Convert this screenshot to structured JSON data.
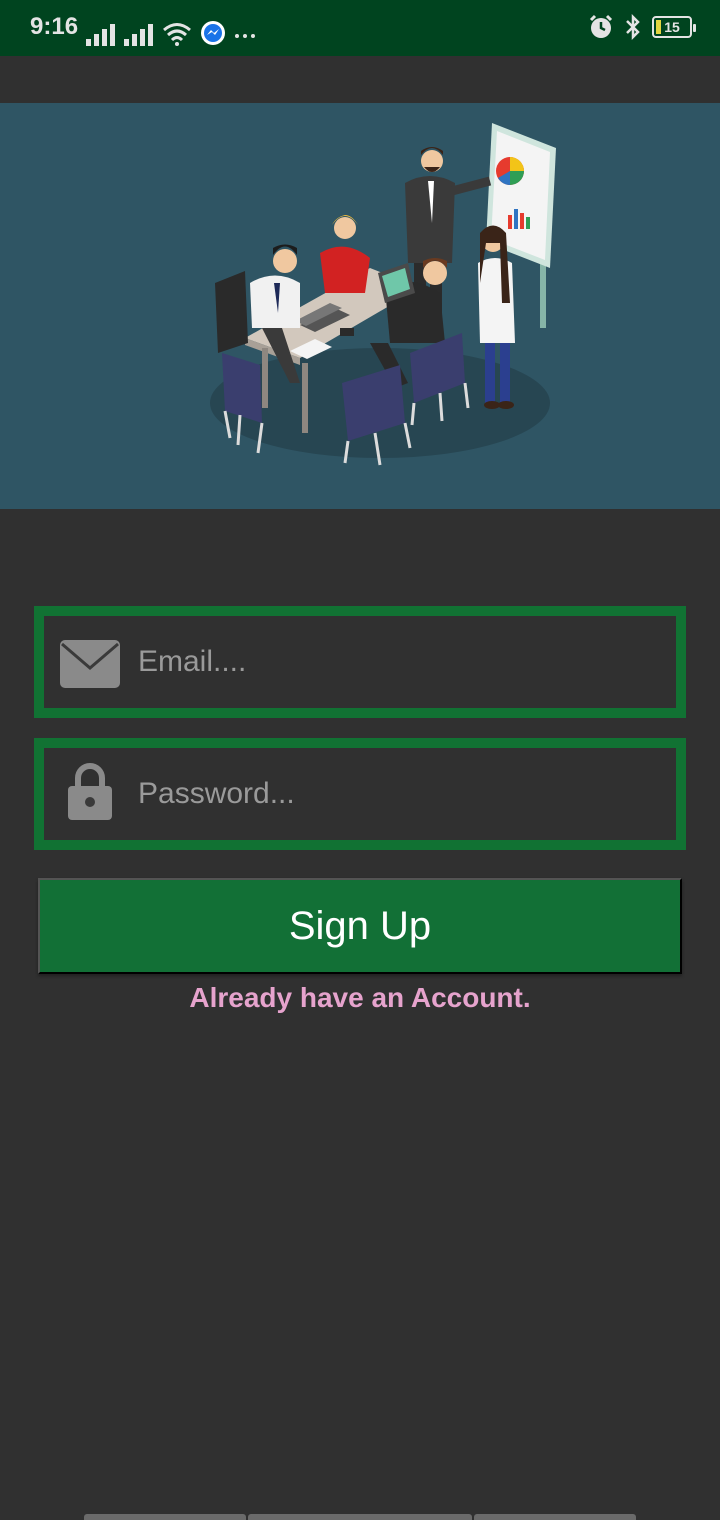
{
  "status_bar": {
    "time": "9:16",
    "battery_level": "15",
    "icons": [
      "signal-icon",
      "signal-icon",
      "wifi-icon",
      "messenger-icon",
      "more-icon",
      "alarm-icon",
      "bluetooth-icon",
      "battery-icon"
    ]
  },
  "form": {
    "email_placeholder": "Email....",
    "password_placeholder": "Password...",
    "signup_label": "Sign Up",
    "login_link": "Already have an Account."
  },
  "colors": {
    "status_bar": "#00441f",
    "background": "#303030",
    "hero_background": "#2f5564",
    "field_border": "#117233",
    "button": "#127036",
    "link": "#e6a3cd"
  }
}
